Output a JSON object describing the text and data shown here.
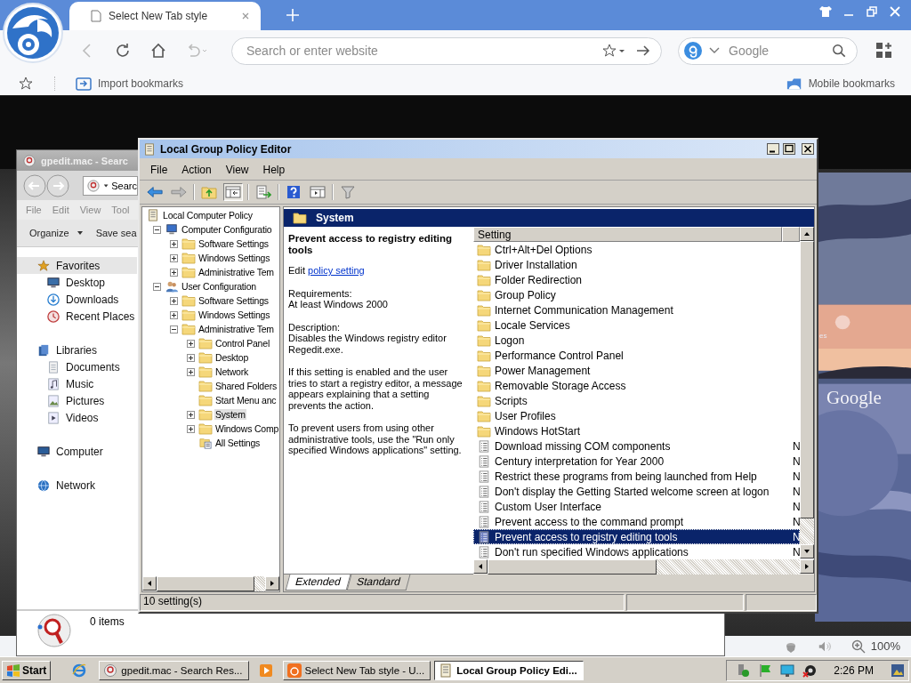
{
  "browser": {
    "tab": {
      "title": "Select New Tab style"
    },
    "address": {
      "placeholder": "Search or enter website"
    },
    "search": {
      "placeholder": "Google"
    },
    "bookmarks": [
      {
        "label": "Import bookmarks"
      }
    ],
    "mobile_bookmarks": "Mobile bookmarks",
    "zoom": "100%"
  },
  "page": {
    "logo_text": "Google",
    "cut_text": "es"
  },
  "explorer": {
    "title": "gpedit.mac - Searc",
    "address": "Searc",
    "menu": [
      "File",
      "Edit",
      "View",
      "Tool"
    ],
    "toolbar": [
      {
        "label": "Organize",
        "dropdown": true
      },
      {
        "label": "Save sea",
        "dropdown": false
      }
    ],
    "nav": [
      {
        "label": "Favorites",
        "kind": "favorites",
        "selected": true,
        "children": [
          {
            "label": "Desktop",
            "kind": "desktop",
            "selected": false
          },
          {
            "label": "Downloads",
            "kind": "downloads",
            "selected": false
          },
          {
            "label": "Recent Places",
            "kind": "recent",
            "selected": false
          }
        ]
      },
      {
        "label": "Libraries",
        "kind": "libraries",
        "selected": false,
        "children": [
          {
            "label": "Documents",
            "kind": "documents",
            "selected": false
          },
          {
            "label": "Music",
            "kind": "music",
            "selected": false
          },
          {
            "label": "Pictures",
            "kind": "pictures",
            "selected": false
          },
          {
            "label": "Videos",
            "kind": "videos",
            "selected": false
          }
        ]
      },
      {
        "label": "Computer",
        "kind": "computer",
        "selected": false
      },
      {
        "label": "Network",
        "kind": "network",
        "selected": false
      }
    ],
    "status": "0 items"
  },
  "gpe": {
    "title": "Local Group Policy Editor",
    "menu": [
      "File",
      "Action",
      "View",
      "Help"
    ],
    "tree": [
      {
        "label": "Local Computer Policy",
        "kind": "policy",
        "selected": false,
        "children": [
          {
            "label": "Computer Configuratio",
            "kind": "computer",
            "expanded": true,
            "selected": false,
            "children": [
              {
                "label": "Software Settings",
                "kind": "folder",
                "expanded": false,
                "selected": false
              },
              {
                "label": "Windows Settings",
                "kind": "folder",
                "expanded": false,
                "selected": false
              },
              {
                "label": "Administrative Tem",
                "kind": "folder",
                "expanded": false,
                "selected": false
              }
            ]
          },
          {
            "label": "User Configuration",
            "kind": "user",
            "expanded": true,
            "selected": false,
            "children": [
              {
                "label": "Software Settings",
                "kind": "folder",
                "expanded": false,
                "selected": false
              },
              {
                "label": "Windows Settings",
                "kind": "folder",
                "expanded": false,
                "selected": false
              },
              {
                "label": "Administrative Tem",
                "kind": "folder",
                "expanded": true,
                "selected": false,
                "children": [
                  {
                    "label": "Control Panel",
                    "kind": "folder",
                    "expanded": false,
                    "selected": false
                  },
                  {
                    "label": "Desktop",
                    "kind": "folder",
                    "expanded": false,
                    "selected": false
                  },
                  {
                    "label": "Network",
                    "kind": "folder",
                    "expanded": false,
                    "selected": false
                  },
                  {
                    "label": "Shared Folders",
                    "kind": "folder",
                    "selected": false
                  },
                  {
                    "label": "Start Menu anc",
                    "kind": "folder",
                    "selected": false
                  },
                  {
                    "label": "System",
                    "kind": "folder",
                    "expanded": false,
                    "selected": true
                  },
                  {
                    "label": "Windows Comp",
                    "kind": "folder",
                    "expanded": false,
                    "selected": false
                  },
                  {
                    "label": "All Settings",
                    "kind": "allsettings",
                    "selected": false
                  }
                ]
              }
            ]
          }
        ]
      }
    ],
    "header": "System",
    "description": {
      "title": "Prevent access to registry editing tools",
      "edit_prefix": "Edit",
      "edit_link": "policy setting",
      "paragraphs": [
        "Requirements:\nAt least Windows 2000",
        "Description:\nDisables the Windows registry editor\nRegedit.exe.",
        "If this setting is enabled and the user\ntries to start a registry editor, a message\nappears explaining that a setting\nprevents the action.",
        "To prevent users from using other\nadministrative tools, use the \"Run only\nspecified Windows applications\" setting."
      ]
    },
    "column": "Setting",
    "rows": [
      {
        "name": "Ctrl+Alt+Del Options",
        "kind": "folder",
        "selected": false
      },
      {
        "name": "Driver Installation",
        "kind": "folder",
        "selected": false
      },
      {
        "name": "Folder Redirection",
        "kind": "folder",
        "selected": false
      },
      {
        "name": "Group Policy",
        "kind": "folder",
        "selected": false
      },
      {
        "name": "Internet Communication Management",
        "kind": "folder",
        "selected": false
      },
      {
        "name": "Locale Services",
        "kind": "folder",
        "selected": false
      },
      {
        "name": "Logon",
        "kind": "folder",
        "selected": false
      },
      {
        "name": "Performance Control Panel",
        "kind": "folder",
        "selected": false
      },
      {
        "name": "Power Management",
        "kind": "folder",
        "selected": false
      },
      {
        "name": "Removable Storage Access",
        "kind": "folder",
        "selected": false
      },
      {
        "name": "Scripts",
        "kind": "folder",
        "selected": false
      },
      {
        "name": "User Profiles",
        "kind": "folder",
        "selected": false
      },
      {
        "name": "Windows HotStart",
        "kind": "folder",
        "selected": false
      },
      {
        "name": "Download missing COM components",
        "kind": "setting",
        "state": "N",
        "selected": false
      },
      {
        "name": "Century interpretation for Year 2000",
        "kind": "setting",
        "state": "N",
        "selected": false
      },
      {
        "name": "Restrict these programs from being launched from Help",
        "kind": "setting",
        "state": "N",
        "selected": false
      },
      {
        "name": "Don't display the Getting Started welcome screen at logon",
        "kind": "setting",
        "state": "N",
        "selected": false
      },
      {
        "name": "Custom User Interface",
        "kind": "setting",
        "state": "N",
        "selected": false
      },
      {
        "name": "Prevent access to the command prompt",
        "kind": "setting",
        "state": "N",
        "selected": false
      },
      {
        "name": "Prevent access to registry editing tools",
        "kind": "setting",
        "state": "N",
        "selected": true
      },
      {
        "name": "Don't run specified Windows applications",
        "kind": "setting",
        "state": "N",
        "selected": false
      }
    ],
    "tabs": [
      {
        "label": "Extended",
        "selected": true
      },
      {
        "label": "Standard",
        "selected": false
      }
    ],
    "status": "10 setting(s)"
  },
  "taskbar": {
    "start": "Start",
    "tasks": [
      {
        "label": "gpedit.mac - Search Res...",
        "kind": "search",
        "selected": false
      },
      {
        "kind": "media",
        "selected": false
      },
      {
        "label": "Select New Tab style - U...",
        "kind": "browser",
        "selected": false
      },
      {
        "label": "Local Group Policy Edi...",
        "kind": "policy",
        "selected": true
      }
    ],
    "time": "2:26 PM"
  }
}
